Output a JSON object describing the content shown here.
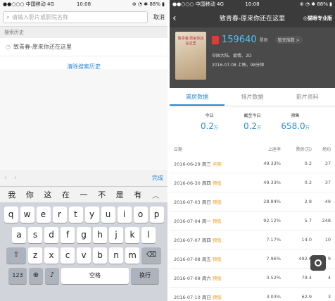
{
  "left": {
    "status": {
      "carrier": "●●○○○ 中国移动 4G",
      "time": "10:08",
      "right": "⊕ ◔ ✱ 88% ▮"
    },
    "search": {
      "placeholder": "请输入影片或影院名称",
      "cancel": "取消"
    },
    "history_header": "搜索历史",
    "history_items": [
      "致青春-原来你还在这里"
    ],
    "clear_history": "清除搜索历史",
    "keyboard": {
      "done": "完成",
      "candidates": [
        "我",
        "你",
        "这",
        "在",
        "一",
        "不",
        "是",
        "有"
      ],
      "row1": [
        "q",
        "w",
        "e",
        "r",
        "t",
        "y",
        "u",
        "i",
        "o",
        "p"
      ],
      "row2": [
        "a",
        "s",
        "d",
        "f",
        "g",
        "h",
        "j",
        "k",
        "l"
      ],
      "row3": [
        "z",
        "x",
        "c",
        "v",
        "b",
        "n",
        "m"
      ],
      "numbers": "123",
      "space": "空格",
      "return": "换行"
    }
  },
  "right": {
    "status": {
      "carrier": "●●○○○ 中国移动 4G",
      "time": "10:08",
      "right": "⊕ ◔ ✱ 88% ▮"
    },
    "nav": {
      "title": "致青春-原来你还在这里",
      "logo": "◎猫眼专业版"
    },
    "movie": {
      "poster_text": "致青春 原来你还在这里",
      "box_office": "159640",
      "box_office_unit": "票房",
      "rating": "暂无指数 >",
      "meta1": "中国大陆、爱情、2D",
      "meta2": "2016-07-08 上映，98分钟"
    },
    "tabs": [
      "票房数据",
      "排片数据",
      "影片资料"
    ],
    "summary": [
      {
        "label": "今日",
        "value": "0.2",
        "unit": "万"
      },
      {
        "label": "截至今日",
        "value": "0.2",
        "unit": "万"
      },
      {
        "label": "预售",
        "value": "658.0",
        "unit": "万"
      }
    ],
    "table": {
      "headers": [
        "日期",
        "上座率",
        "票房(万)",
        "场均"
      ],
      "rows": [
        {
          "date": "2016-06-29 周三",
          "tag": "点映",
          "rate": "49.33%",
          "box": "0.2",
          "avg": "37"
        },
        {
          "date": "2016-06-30 周四",
          "tag": "预售",
          "rate": "49.33%",
          "box": "0.2",
          "avg": "37"
        },
        {
          "date": "2016-07-03 周日",
          "tag": "预售",
          "rate": "28.84%",
          "box": "2.8",
          "avg": "49"
        },
        {
          "date": "2016-07-04 周一",
          "tag": "预售",
          "rate": "92.12%",
          "box": "5.7",
          "avg": "248"
        },
        {
          "date": "2016-07-07 周四",
          "tag": "预售",
          "rate": "7.17%",
          "box": "14.0",
          "avg": "10"
        },
        {
          "date": "2016-07-08 周五",
          "tag": "预售",
          "rate": "7.96%",
          "box": "492.6",
          "avg": "9"
        },
        {
          "date": "2016-07-09 周六",
          "tag": "预售",
          "rate": "3.52%",
          "box": "79.4",
          "avg": "4"
        },
        {
          "date": "2016-07-10 周日",
          "tag": "预售",
          "rate": "3.03%",
          "box": "62.9",
          "avg": "3"
        }
      ]
    }
  }
}
